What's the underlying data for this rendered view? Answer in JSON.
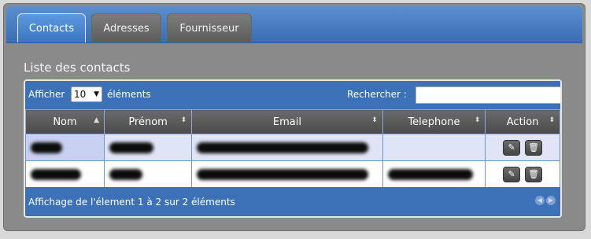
{
  "tabs": [
    {
      "label": "Contacts",
      "active": true
    },
    {
      "label": "Adresses",
      "active": false
    },
    {
      "label": "Fournisseur",
      "active": false
    }
  ],
  "section_title": "Liste des contacts",
  "toolbar": {
    "show_label": "Afficher",
    "page_size": "10",
    "elements_label": "éléments",
    "search_label": "Rechercher :",
    "search_value": ""
  },
  "table": {
    "columns": [
      "Nom",
      "Prénom",
      "Email",
      "Telephone",
      "Action"
    ]
  },
  "footer": {
    "info": "Affichage de l'élement 1 à 2 sur 2 éléments"
  },
  "icons": {
    "edit": "pencil-icon",
    "delete": "trash-icon",
    "sort": "sort-icon"
  },
  "colors": {
    "accent": "#3c71b8",
    "header": "#555555",
    "row_odd": "#dfe4f7"
  }
}
